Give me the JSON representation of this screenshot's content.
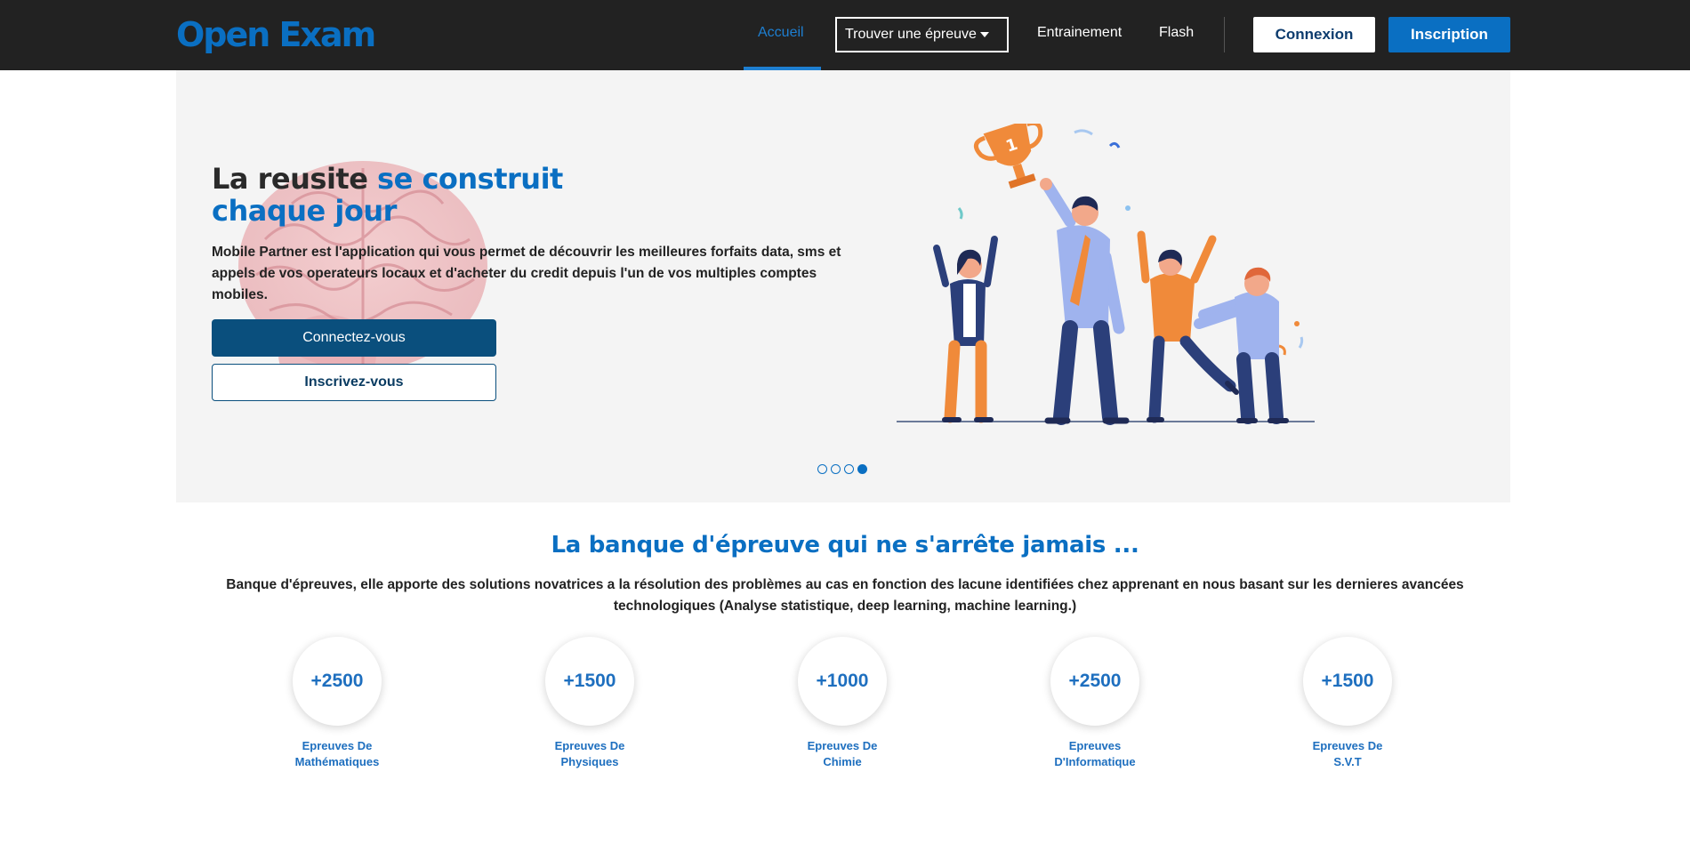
{
  "navbar": {
    "logo": "Open Exam",
    "links": {
      "accueil": "Accueil",
      "trouver": "Trouver une épreuve",
      "entrainement": "Entrainement",
      "flash": "Flash"
    },
    "connexion": "Connexion",
    "inscription": "Inscription"
  },
  "hero": {
    "title_part1": "La reusite ",
    "title_part2": "se construit chaque jour",
    "description": "Mobile Partner est l'application qui vous permet de découvrir les meilleures forfaits data, sms et appels de vos operateurs locaux et d'acheter du credit depuis l'un de vos multiples comptes mobiles.",
    "btn_primary": "Connectez-vous",
    "btn_secondary": "Inscrivez-vous",
    "carousel_active_index": 4,
    "carousel_total": 4
  },
  "section": {
    "title": "La banque d'épreuve qui ne s'arrête jamais ...",
    "description": "Banque d'épreuves, elle apporte des solutions novatrices a la résolution des problèmes au cas en fonction des lacune identifiées chez apprenant en nous basant sur les dernieres avancées technologiques (Analyse statistique, deep learning, machine learning.)"
  },
  "stats": [
    {
      "value": "+2500",
      "label_line1": "Epreuves De",
      "label_line2": "Mathématiques"
    },
    {
      "value": "+1500",
      "label_line1": "Epreuves De",
      "label_line2": "Physiques"
    },
    {
      "value": "+1000",
      "label_line1": "Epreuves De",
      "label_line2": "Chimie"
    },
    {
      "value": "+2500",
      "label_line1": "Epreuves",
      "label_line2": "D'Informatique"
    },
    {
      "value": "+1500",
      "label_line1": "Epreuves De",
      "label_line2": "S.V.T"
    }
  ],
  "colors": {
    "brand_blue": "#0a6fc2",
    "navbar_bg": "#222222",
    "primary_button": "#0a4f7d"
  },
  "icons": {
    "caret": "caret-down-icon",
    "hero_background": "brain-illustration",
    "hero_image": "team-trophy-illustration"
  }
}
